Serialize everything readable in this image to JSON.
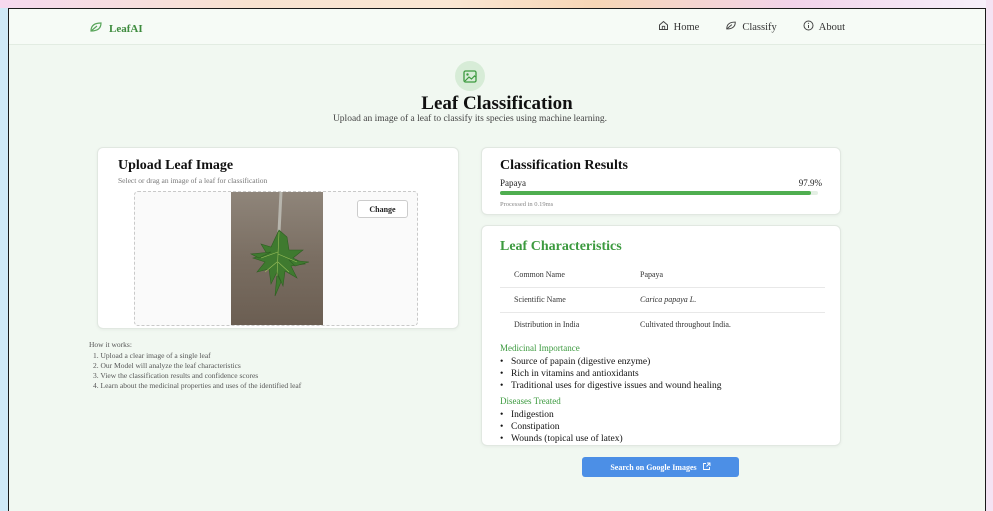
{
  "app": {
    "brand": "LeafAI"
  },
  "nav": {
    "items": [
      {
        "label": "Home",
        "icon": "home-icon"
      },
      {
        "label": "Classify",
        "icon": "leaf-icon"
      },
      {
        "label": "About",
        "icon": "info-icon"
      }
    ]
  },
  "hero": {
    "icon": "image-icon",
    "title": "Leaf Classification",
    "subtitle": "Upload an image of a leaf to classify its species using machine learning."
  },
  "upload": {
    "title": "Upload Leaf Image",
    "subtitle": "Select or drag an image of a leaf for classification",
    "change_label": "Change"
  },
  "how": {
    "heading": "How it works:",
    "steps": [
      "1. Upload a clear image of a single leaf",
      "2. Our Model will analyze the leaf characteristics",
      "3. View the classification results and confidence scores",
      "4. Learn about the medicinal properties and uses of the identified leaf"
    ]
  },
  "results": {
    "title": "Classification Results",
    "label": "Papaya",
    "confidence_text": "97.9%",
    "confidence": 0.979,
    "processed": "Processed in 0.19ms"
  },
  "characteristics": {
    "title": "Leaf Characteristics",
    "rows": [
      {
        "key": "Common Name",
        "value": "Papaya"
      },
      {
        "key": "Scientific Name",
        "value": "Carica papaya L."
      },
      {
        "key": "Distribution in India",
        "value": "Cultivated throughout India."
      }
    ],
    "medicinal_heading": "Medicinal Importance",
    "medicinal": [
      "Source of papain (digestive enzyme)",
      "Rich in vitamins and antioxidants",
      "Traditional uses for digestive issues and wound healing"
    ],
    "diseases_heading": "Diseases Treated",
    "diseases": [
      "Indigestion",
      "Constipation",
      "Wounds (topical use of latex)"
    ]
  },
  "search_button": {
    "label": "Search on Google Images",
    "icon": "external-link-icon"
  },
  "colors": {
    "accent_green": "#3c9a3f",
    "progress_green": "#4fae50",
    "button_blue": "#4c8fe6",
    "page_bg": "#f1f8f1"
  }
}
